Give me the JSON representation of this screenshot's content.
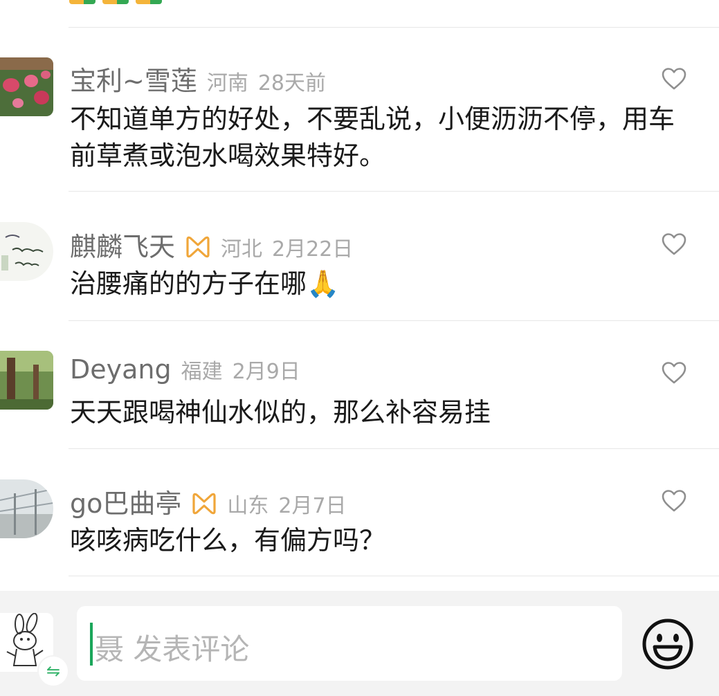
{
  "comments": [
    {
      "name": "宝利~雪莲",
      "vip": false,
      "region": "河南",
      "time": "28天前",
      "content": "不知道单方的好处，不要乱说，小便沥沥不停，用车前草煮或泡水喝效果特好。"
    },
    {
      "name": "麒麟飞天",
      "vip": true,
      "region": "河北",
      "time": "2月22日",
      "content": "治腰痛的的方子在哪🙏"
    },
    {
      "name": "Deyang",
      "vip": false,
      "region": "福建",
      "time": "2月9日",
      "content": "天天跟喝神仙水似的，那么补容易挂"
    },
    {
      "name": "go巴曲亭",
      "vip": true,
      "region": "山东",
      "time": "2月7日",
      "content": "咳咳病吃什么，有偏方吗？"
    }
  ],
  "composer": {
    "placeholder": "聂 发表评论",
    "switch_icon": "⇋"
  },
  "colors": {
    "accent": "#1aa65a",
    "vip_badge": "#f0a63a",
    "muted_text": "#a9a9a9"
  },
  "icons": [
    "heart-outline-icon",
    "vip-badge-icon",
    "emoji-smile-icon",
    "switch-account-icon"
  ]
}
